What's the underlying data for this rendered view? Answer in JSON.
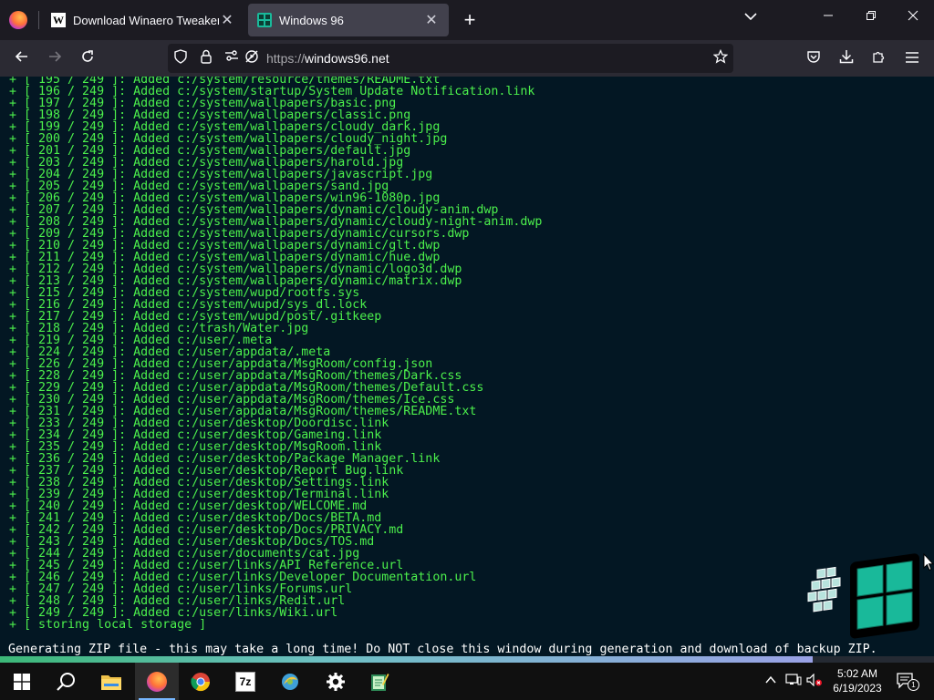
{
  "browser": {
    "tabs": [
      {
        "title": "Download Winaero Tweaker",
        "favicon": "W",
        "active": false
      },
      {
        "title": "Windows 96",
        "favicon": "windows96-logo",
        "active": true
      }
    ],
    "url_protocol": "https://",
    "url_host": "windows96.net"
  },
  "terminal": {
    "log_lines": [
      "+ [ 195 / 249 ]: Added c:/system/resource/themes/README.txt",
      "+ [ 196 / 249 ]: Added c:/system/startup/System Update Notification.link",
      "+ [ 197 / 249 ]: Added c:/system/wallpapers/basic.png",
      "+ [ 198 / 249 ]: Added c:/system/wallpapers/classic.png",
      "+ [ 199 / 249 ]: Added c:/system/wallpapers/cloudy_dark.jpg",
      "+ [ 200 / 249 ]: Added c:/system/wallpapers/cloudy_night.jpg",
      "+ [ 201 / 249 ]: Added c:/system/wallpapers/default.jpg",
      "+ [ 203 / 249 ]: Added c:/system/wallpapers/harold.jpg",
      "+ [ 204 / 249 ]: Added c:/system/wallpapers/javascript.jpg",
      "+ [ 205 / 249 ]: Added c:/system/wallpapers/sand.jpg",
      "+ [ 206 / 249 ]: Added c:/system/wallpapers/win96-1080p.jpg",
      "+ [ 207 / 249 ]: Added c:/system/wallpapers/dynamic/cloudy-anim.dwp",
      "+ [ 208 / 249 ]: Added c:/system/wallpapers/dynamic/cloudy-night-anim.dwp",
      "+ [ 209 / 249 ]: Added c:/system/wallpapers/dynamic/cursors.dwp",
      "+ [ 210 / 249 ]: Added c:/system/wallpapers/dynamic/glt.dwp",
      "+ [ 211 / 249 ]: Added c:/system/wallpapers/dynamic/hue.dwp",
      "+ [ 212 / 249 ]: Added c:/system/wallpapers/dynamic/logo3d.dwp",
      "+ [ 213 / 249 ]: Added c:/system/wallpapers/dynamic/matrix.dwp",
      "+ [ 215 / 249 ]: Added c:/system/wupd/rootfs.sys",
      "+ [ 216 / 249 ]: Added c:/system/wupd/sys_dl.lock",
      "+ [ 217 / 249 ]: Added c:/system/wupd/post/.gitkeep",
      "+ [ 218 / 249 ]: Added c:/trash/Water.jpg",
      "+ [ 219 / 249 ]: Added c:/user/.meta",
      "+ [ 224 / 249 ]: Added c:/user/appdata/.meta",
      "+ [ 226 / 249 ]: Added c:/user/appdata/MsgRoom/config.json",
      "+ [ 228 / 249 ]: Added c:/user/appdata/MsgRoom/themes/Dark.css",
      "+ [ 229 / 249 ]: Added c:/user/appdata/MsgRoom/themes/Default.css",
      "+ [ 230 / 249 ]: Added c:/user/appdata/MsgRoom/themes/Ice.css",
      "+ [ 231 / 249 ]: Added c:/user/appdata/MsgRoom/themes/README.txt",
      "+ [ 233 / 249 ]: Added c:/user/desktop/Doordisc.link",
      "+ [ 234 / 249 ]: Added c:/user/desktop/Gameing.link",
      "+ [ 235 / 249 ]: Added c:/user/desktop/MsgRoom.link",
      "+ [ 236 / 249 ]: Added c:/user/desktop/Package Manager.link",
      "+ [ 237 / 249 ]: Added c:/user/desktop/Report Bug.link",
      "+ [ 238 / 249 ]: Added c:/user/desktop/Settings.link",
      "+ [ 239 / 249 ]: Added c:/user/desktop/Terminal.link",
      "+ [ 240 / 249 ]: Added c:/user/desktop/WELCOME.md",
      "+ [ 241 / 249 ]: Added c:/user/desktop/Docs/BETA.md",
      "+ [ 242 / 249 ]: Added c:/user/desktop/Docs/PRIVACY.md",
      "+ [ 243 / 249 ]: Added c:/user/desktop/Docs/TOS.md",
      "+ [ 244 / 249 ]: Added c:/user/documents/cat.jpg",
      "+ [ 245 / 249 ]: Added c:/user/links/API Reference.url",
      "+ [ 246 / 249 ]: Added c:/user/links/Developer Documentation.url",
      "+ [ 247 / 249 ]: Added c:/user/links/Forums.url",
      "+ [ 248 / 249 ]: Added c:/user/links/Redit.url",
      "+ [ 249 / 249 ]: Added c:/user/links/Wiki.url",
      "+ [ storing local storage ]"
    ],
    "status_message": "Generating ZIP file - this may take a long time! Do NOT close this window during generation and download of backup ZIP.",
    "progress_fraction": 0.87
  },
  "taskbar": {
    "apps": [
      "start-windows-icon",
      "search-icon",
      "file-explorer-icon",
      "firefox-icon",
      "chrome-icon",
      "7zip-icon",
      "winaero-tweaker-icon",
      "settings-gear-icon",
      "notepad-icon"
    ],
    "active_app": "firefox-icon",
    "clock_time": "5:02 AM",
    "clock_date": "6/19/2023",
    "notification_count": "1"
  },
  "colors": {
    "terminal_bg": "#031723",
    "terminal_text": "#4cf04c",
    "logo_teal": "#19b99a"
  }
}
